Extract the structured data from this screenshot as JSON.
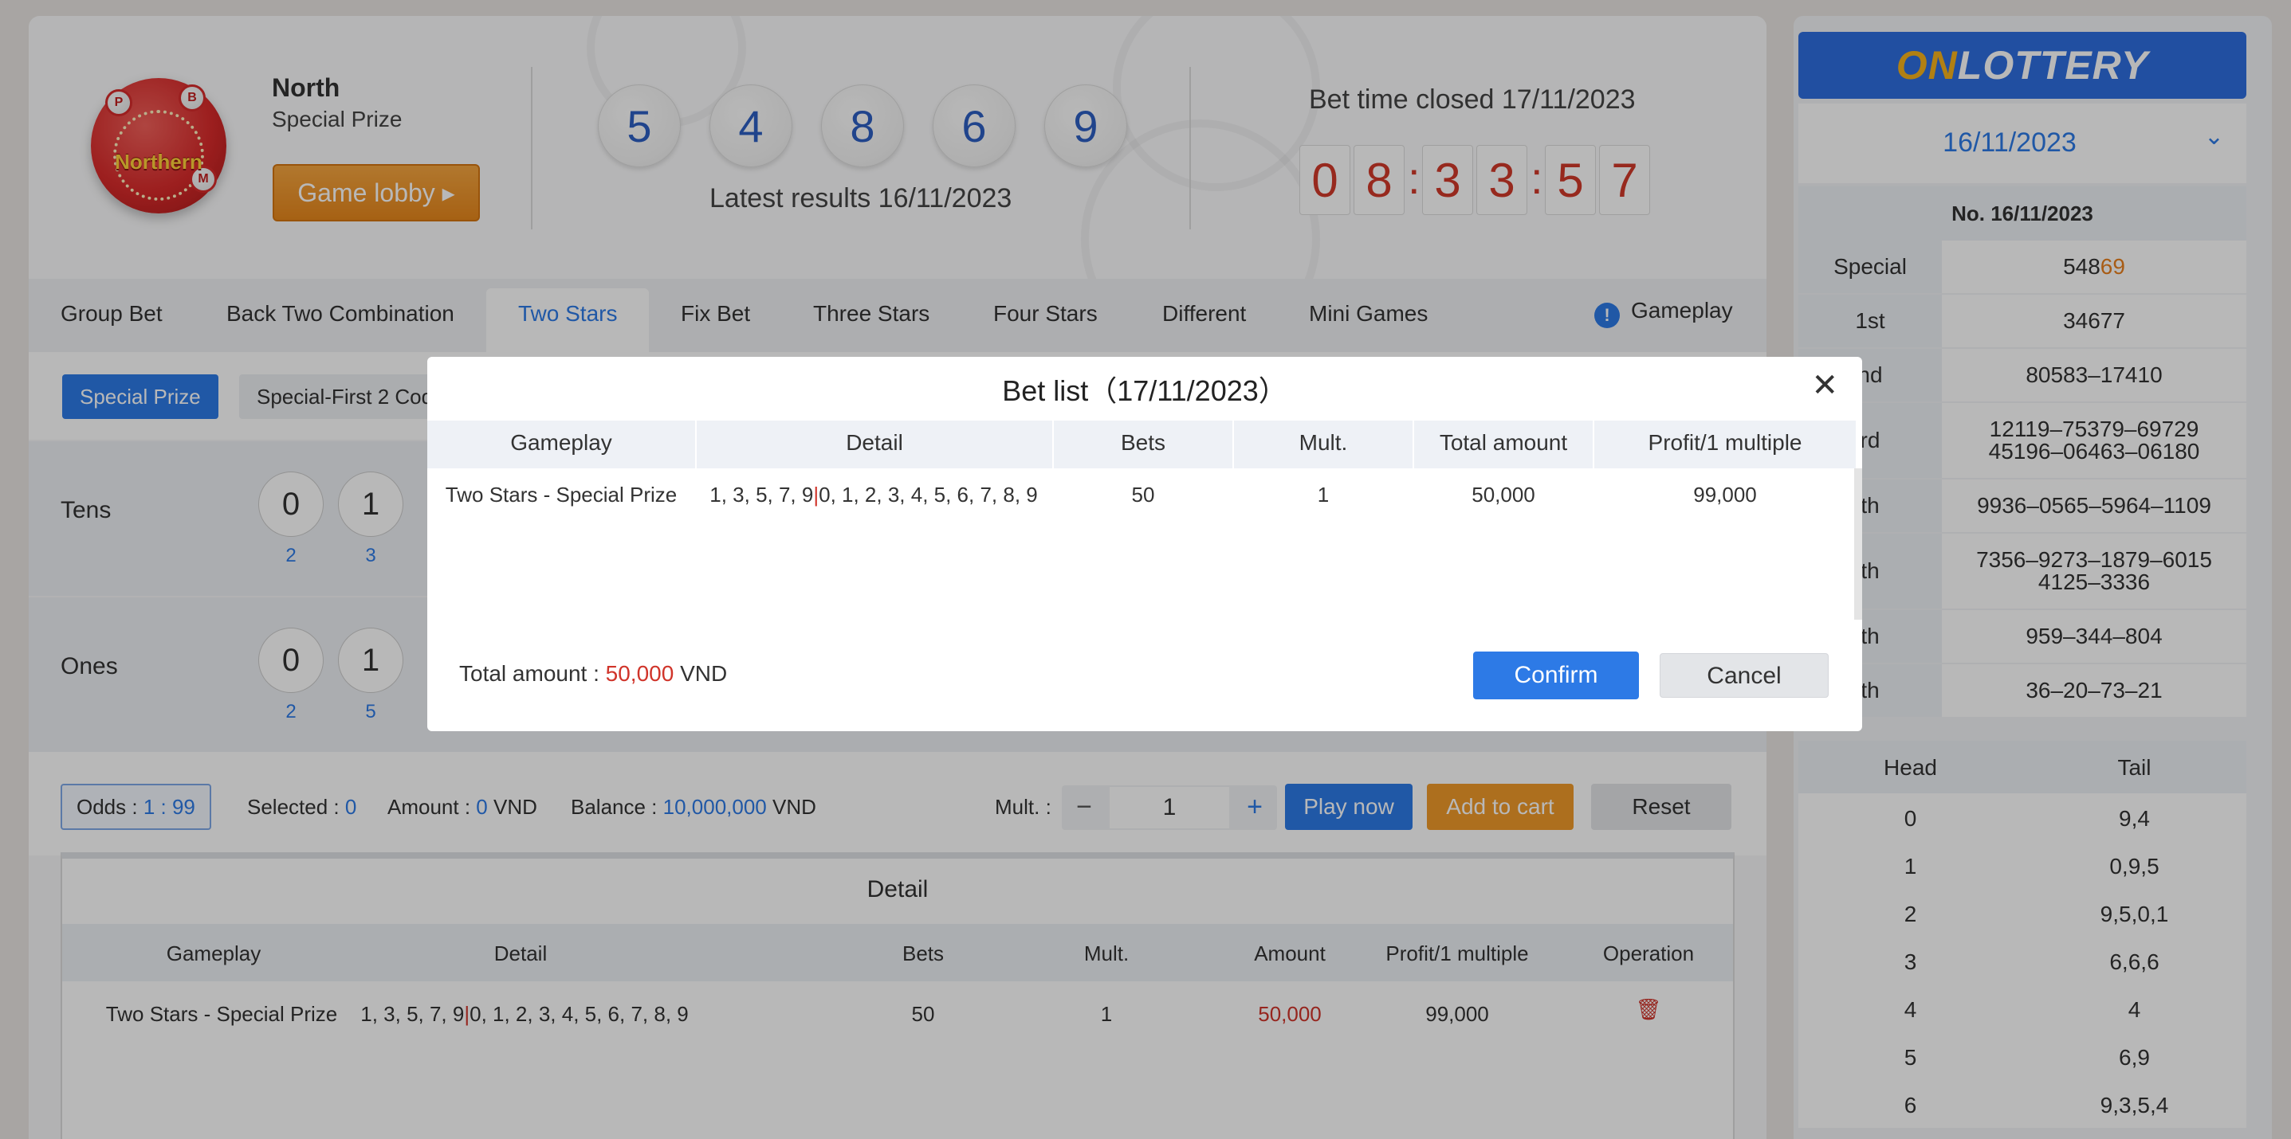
{
  "region": {
    "name": "North",
    "prize": "Special Prize",
    "logo_text": "Northern"
  },
  "lobby_button": "Game lobby ▸",
  "results": {
    "balls": [
      "5",
      "4",
      "8",
      "6",
      "9"
    ],
    "caption": "Latest results 16/11/2023"
  },
  "countdown": {
    "label": "Bet time closed 17/11/2023",
    "digits": [
      "0",
      "8",
      "3",
      "3",
      "5",
      "7"
    ]
  },
  "tabs": [
    "Group Bet",
    "Back Two Combination",
    "Two Stars",
    "Fix Bet",
    "Three Stars",
    "Four Stars",
    "Different",
    "Mini Games"
  ],
  "gameplay_link": "Gameplay",
  "subtabs": [
    "Special Prize",
    "Special-First 2 Cod"
  ],
  "rows": {
    "tens": {
      "label": "Tens",
      "balls": [
        "0",
        "1"
      ],
      "miss": [
        "2",
        "3"
      ]
    },
    "ones": {
      "label": "Ones",
      "balls": [
        "0",
        "1"
      ],
      "miss": [
        "2",
        "5"
      ]
    }
  },
  "betbar": {
    "odds_label": "Odds : ",
    "odds_value": "1 : 99",
    "selected_label": "Selected : ",
    "selected_value": "0",
    "amount_label": "Amount : ",
    "amount_value": "0",
    "amount_unit": " VND",
    "balance_label": "Balance : ",
    "balance_value": "10,000,000",
    "balance_unit": " VND",
    "mult_label": "Mult. :",
    "mult_minus": "−",
    "mult_value": "1",
    "mult_plus": "+",
    "play_now": "Play now",
    "add_to_cart": "Add to cart",
    "reset": "Reset"
  },
  "detail": {
    "title": "Detail",
    "headers": [
      "Gameplay",
      "Detail",
      "Bets",
      "Mult.",
      "Amount",
      "Profit/1 multiple",
      "Operation"
    ],
    "row": {
      "gameplay": "Two Stars - Special Prize",
      "detail_a": "1, 3, 5, 7, 9",
      "detail_sep": "|",
      "detail_b": "0, 1, 2, 3, 4, 5, 6, 7, 8, 9",
      "bets": "50",
      "mult": "1",
      "amount": "50,000",
      "profit": "99,000"
    }
  },
  "side": {
    "logo_prefix": "ON",
    "logo_suffix": "LOTTERY",
    "date": "16/11/2023",
    "no": "No. 16/11/2023",
    "prizes": [
      {
        "label": "Special",
        "lines": [
          "548"
        ],
        "tail": "69"
      },
      {
        "label": "1st",
        "lines": [
          "34677"
        ]
      },
      {
        "label": "nd",
        "lines": [
          "80583–17410"
        ]
      },
      {
        "label": "rd",
        "lines": [
          "12119–75379–69729",
          "45196–06463–06180"
        ]
      },
      {
        "label": "th",
        "lines": [
          "9936–0565–5964–1109"
        ]
      },
      {
        "label": "th",
        "lines": [
          "7356–9273–1879–6015",
          "4125–3336"
        ]
      },
      {
        "label": "th",
        "lines": [
          "959–344–804"
        ]
      },
      {
        "label": "th",
        "lines": [
          "36–20–73–21"
        ]
      }
    ],
    "head_tail": {
      "headers": [
        "Head",
        "Tail"
      ],
      "rows": [
        [
          "0",
          "9,4"
        ],
        [
          "1",
          "0,9,5"
        ],
        [
          "2",
          "9,5,0,1"
        ],
        [
          "3",
          "6,6,6"
        ],
        [
          "4",
          "4"
        ],
        [
          "5",
          "6,9"
        ],
        [
          "6",
          "9,3,5,4"
        ]
      ]
    }
  },
  "modal": {
    "title": "Bet list（17/11/2023）",
    "close": "✕",
    "headers": [
      "Gameplay",
      "Detail",
      "Bets",
      "Mult.",
      "Total amount",
      "Profit/1 multiple"
    ],
    "row": {
      "gameplay": "Two Stars - Special Prize",
      "detail_a": "1, 3, 5, 7, 9",
      "detail_sep": "|",
      "detail_b": "0, 1, 2, 3, 4, 5, 6, 7, 8, 9",
      "bets": "50",
      "mult": "1",
      "total": "50,000",
      "profit": "99,000"
    },
    "total_label": "Total amount : ",
    "total_value": "50,000",
    "total_unit": " VND",
    "confirm": "Confirm",
    "cancel": "Cancel"
  },
  "colors": {
    "accent": "#2d7ae6",
    "red": "#d0342a",
    "orange": "#f09a2a"
  }
}
